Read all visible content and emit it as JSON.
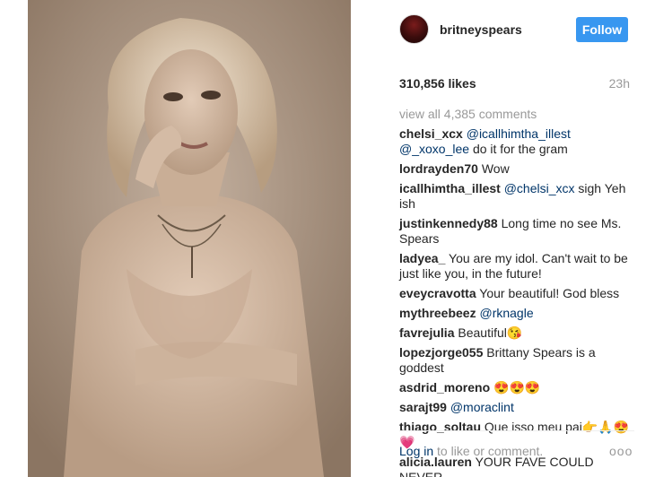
{
  "post": {
    "username": "britneyspears",
    "follow_label": "Follow",
    "likes": "310,856 likes",
    "time": "23h",
    "view_all": "view all 4,385 comments"
  },
  "comments": [
    {
      "user": "chelsi_xcx",
      "mention": "@icallhimtha_illest @_xoxo_lee",
      "text": "do it for the gram"
    },
    {
      "user": "lordrayden70",
      "mention": "",
      "text": "Wow"
    },
    {
      "user": "icallhimtha_illest",
      "mention": "@chelsi_xcx",
      "text": "sigh Yeh ish"
    },
    {
      "user": "justinkennedy88",
      "mention": "",
      "text": "Long time no see Ms. Spears"
    },
    {
      "user": "ladyea_",
      "mention": "",
      "text": "You are my idol. Can't wait to be just like you, in the future!"
    },
    {
      "user": "eveycravotta",
      "mention": "",
      "text": "Your beautiful! God bless"
    },
    {
      "user": "mythreebeez",
      "mention": "@rknagle",
      "text": ""
    },
    {
      "user": "favrejulia",
      "mention": "",
      "text": "Beautiful😘"
    },
    {
      "user": "lopezjorge055",
      "mention": "",
      "text": "Brittany Spears is a goddest"
    },
    {
      "user": "asdrid_moreno",
      "mention": "",
      "text": "😍😍😍"
    },
    {
      "user": "sarajt99",
      "mention": "@moraclint",
      "text": ""
    },
    {
      "user": "thiago_soltau",
      "mention": "",
      "text": "Que isso meu pai👉🙏😍💗"
    },
    {
      "user": "alicia.lauren",
      "mention": "",
      "text": "YOUR FAVE COULD NEVER"
    }
  ],
  "footer": {
    "login_link": "Log in",
    "login_suffix": "to like or comment.",
    "more": "ooo"
  },
  "colors": {
    "follow_button": "#3897f0",
    "link": "#003569",
    "muted": "#999999"
  }
}
